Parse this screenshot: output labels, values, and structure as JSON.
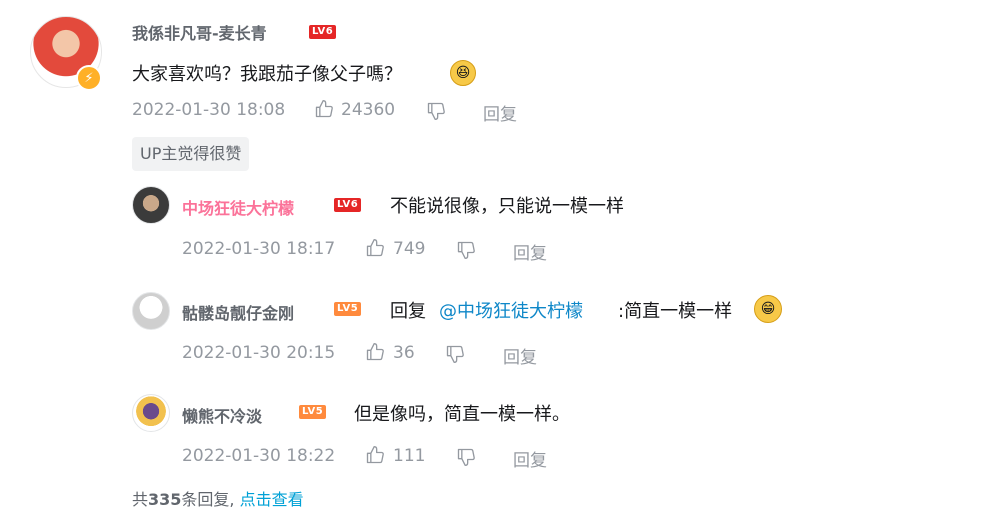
{
  "main_comment": {
    "username": "我係非凡哥-麦长青",
    "level": "LV6",
    "text": "大家喜欢呜？我跟茄子像父子嗎？",
    "emoji_icon": "laughing-face-icon",
    "time": "2022-01-30 18:08",
    "likes": "24360",
    "reply_label": "回复",
    "tag": "UP主觉得很赞"
  },
  "replies": [
    {
      "username": "中场狂徒大柠檬",
      "level": "LV6",
      "text": "不能说很像，只能说一模一样",
      "time": "2022-01-30 18:17",
      "likes": "749",
      "reply_label": "回复"
    },
    {
      "username": "骷髅岛靓仔金刚",
      "level": "LV5",
      "prefix": "回复",
      "mention": "@中场狂徒大柠檬",
      "text": ":简直一模一样",
      "emoji_icon": "grinning-face-icon",
      "time": "2022-01-30 20:15",
      "likes": "36",
      "reply_label": "回复"
    },
    {
      "username": "懒熊不冷淡",
      "level": "LV5",
      "text": "但是像吗，简直一模一样。",
      "time": "2022-01-30 18:22",
      "likes": "111",
      "reply_label": "回复"
    }
  ],
  "footer": {
    "prefix": "共",
    "count": "335",
    "suffix": "条回复,",
    "link": "点击查看"
  },
  "colors": {
    "pink_username": "#fb7299",
    "link": "#00a1d6",
    "lv6": "#e52626",
    "lv5": "#ff8a3d"
  }
}
